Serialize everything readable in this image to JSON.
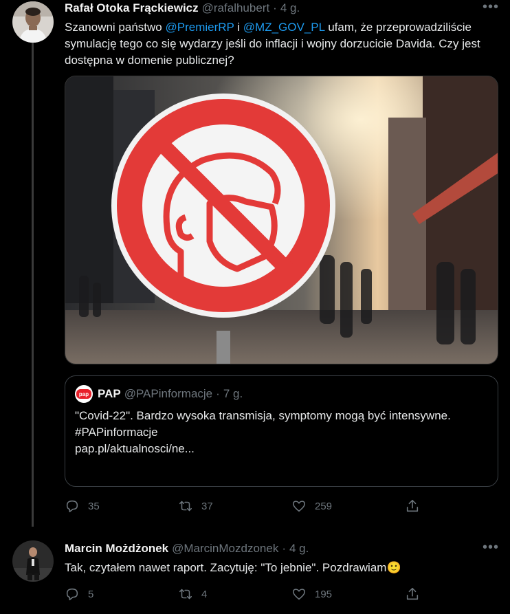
{
  "tweet1": {
    "name": "Rafał Otoka Frąckiewicz",
    "handle": "@rafalhubert",
    "dot": "·",
    "time": "4 g.",
    "more": "•••",
    "text_before": "Szanowni państwo ",
    "mention1": "@PremierRP",
    "text_mid": " i ",
    "mention2": "@MZ_GOV_PL",
    "text_after": " ufam, że przeprowadziliście symulację tego co się wydarzy jeśli do inflacji i wojny dorzucicie Davida. Czy jest dostępna w domenie publicznej?",
    "quote": {
      "logo_text": "pap",
      "name": "PAP",
      "handle": "@PAPinformacje",
      "dot": "·",
      "time": "7 g.",
      "line1": "\"Covid-22\". Bardzo wysoka transmisja, symptomy mogą być intensywne.",
      "line2": "#PAPinformacje",
      "line3": "pap.pl/aktualnosci/ne..."
    },
    "actions": {
      "replies": "35",
      "retweets": "37",
      "likes": "259"
    }
  },
  "tweet2": {
    "name": "Marcin Możdżonek",
    "handle": "@MarcinMozdzonek",
    "dot": "·",
    "time": "4 g.",
    "more": "•••",
    "text": "Tak, czytałem nawet raport. Zacytuję: \"To jebnie\". Pozdrawiam",
    "emoji": "🙂",
    "actions": {
      "replies": "5",
      "retweets": "4",
      "likes": "195"
    }
  },
  "colors": {
    "accent": "#1d9bf0",
    "muted": "#6e767d",
    "background": "#000000"
  },
  "icons": [
    "reply-icon",
    "retweet-icon",
    "like-icon",
    "share-icon",
    "more-icon"
  ]
}
